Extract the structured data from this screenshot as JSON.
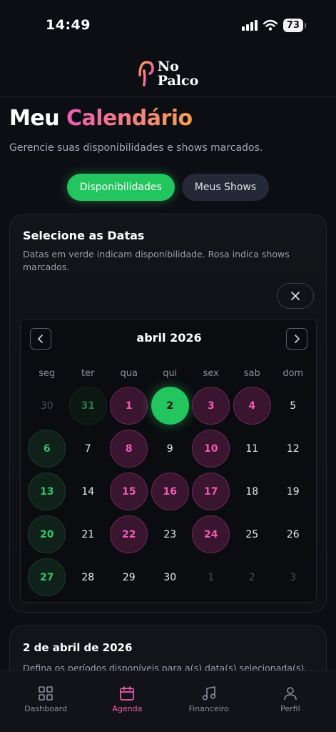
{
  "status": {
    "time": "14:49",
    "battery": "73"
  },
  "header": {
    "logo_line1": "No",
    "logo_line2": "Palco"
  },
  "page": {
    "title_main": "Meu",
    "title_accent": "Calendário",
    "subtitle": "Gerencie suas disponibilidades e shows marcados."
  },
  "tabs": [
    {
      "label": "Disponibilidades",
      "active": true
    },
    {
      "label": "Meus Shows",
      "active": false
    }
  ],
  "select_card": {
    "title": "Selecione as Datas",
    "description": "Datas em verde indicam disponibilidade. Rosa indica shows marcados."
  },
  "calendar": {
    "month": "abril 2026",
    "weekdays": [
      "seg",
      "ter",
      "qua",
      "qui",
      "sex",
      "sab",
      "dom"
    ],
    "weeks": [
      [
        {
          "day": "30",
          "state": "outside"
        },
        {
          "day": "31",
          "state": "available-outside"
        },
        {
          "day": "1",
          "state": "show"
        },
        {
          "day": "2",
          "state": "selected"
        },
        {
          "day": "3",
          "state": "show"
        },
        {
          "day": "4",
          "state": "show"
        },
        {
          "day": "5",
          "state": "normal"
        }
      ],
      [
        {
          "day": "6",
          "state": "available"
        },
        {
          "day": "7",
          "state": "normal"
        },
        {
          "day": "8",
          "state": "show"
        },
        {
          "day": "9",
          "state": "normal"
        },
        {
          "day": "10",
          "state": "show"
        },
        {
          "day": "11",
          "state": "normal"
        },
        {
          "day": "12",
          "state": "normal"
        }
      ],
      [
        {
          "day": "13",
          "state": "available"
        },
        {
          "day": "14",
          "state": "normal"
        },
        {
          "day": "15",
          "state": "show"
        },
        {
          "day": "16",
          "state": "show"
        },
        {
          "day": "17",
          "state": "show"
        },
        {
          "day": "18",
          "state": "normal"
        },
        {
          "day": "19",
          "state": "normal"
        }
      ],
      [
        {
          "day": "20",
          "state": "available"
        },
        {
          "day": "21",
          "state": "normal"
        },
        {
          "day": "22",
          "state": "show"
        },
        {
          "day": "23",
          "state": "normal"
        },
        {
          "day": "24",
          "state": "show"
        },
        {
          "day": "25",
          "state": "normal"
        },
        {
          "day": "26",
          "state": "normal"
        }
      ],
      [
        {
          "day": "27",
          "state": "available"
        },
        {
          "day": "28",
          "state": "normal"
        },
        {
          "day": "29",
          "state": "normal"
        },
        {
          "day": "30",
          "state": "normal"
        },
        {
          "day": "1",
          "state": "outside"
        },
        {
          "day": "2",
          "state": "outside"
        },
        {
          "day": "3",
          "state": "outside"
        }
      ]
    ]
  },
  "period_card": {
    "title": "2 de abril de 2026",
    "description": "Defina os períodos disponíveis para a(s) data(s) selecionada(s)."
  },
  "bottom_nav": [
    {
      "label": "Dashboard",
      "icon": "dashboard-icon",
      "active": false
    },
    {
      "label": "Agenda",
      "icon": "calendar-icon",
      "active": true
    },
    {
      "label": "Financeiro",
      "icon": "music-note-icon",
      "active": false
    },
    {
      "label": "Perfil",
      "icon": "user-icon",
      "active": false
    }
  ],
  "colors": {
    "available": "#22c55e",
    "show": "#f05bb5",
    "accent_gradient_end": "#f7a14c"
  }
}
